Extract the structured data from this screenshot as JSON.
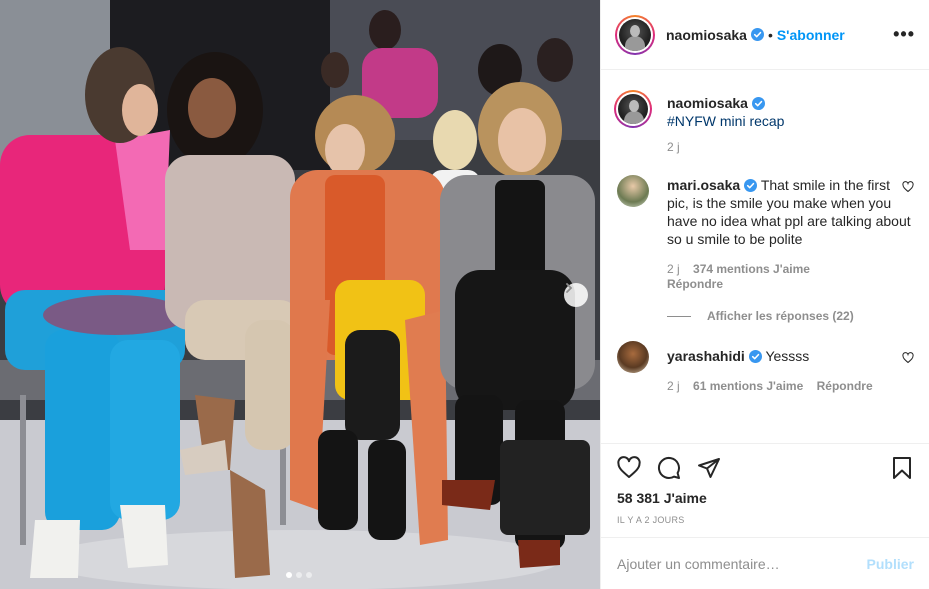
{
  "post": {
    "photo_alt": "photo",
    "carousel": {
      "total": 3,
      "active": 1
    }
  },
  "header": {
    "username": "naomiosaka",
    "separator": "•",
    "follow_label": "S'abonner",
    "more_label": "•••"
  },
  "caption": {
    "username": "naomiosaka",
    "text": "#NYFW mini recap",
    "time": "2 j"
  },
  "comments": [
    {
      "username": "mari.osaka",
      "text": "That smile in the first pic, is the smile you make when you have no idea what ppl are talking about so u smile to be polite",
      "time": "2 j",
      "likes": "374 mentions J'aime",
      "reply": "Répondre",
      "view_replies": "Afficher les réponses (22)"
    },
    {
      "username": "yarashahidi",
      "text": "Yessss",
      "time": "2 j",
      "likes": "61 mentions J'aime",
      "reply": "Répondre"
    }
  ],
  "actions": {
    "like_count": "58 381 J'aime",
    "date": "IL Y A 2 JOURS"
  },
  "add_comment": {
    "placeholder": "Ajouter un commentaire…",
    "publish_label": "Publier"
  },
  "colors": {
    "accent": "#0095f6",
    "verified": "#3897f0",
    "muted": "#8e8e8e",
    "publish_disabled": "#b2dffc"
  }
}
